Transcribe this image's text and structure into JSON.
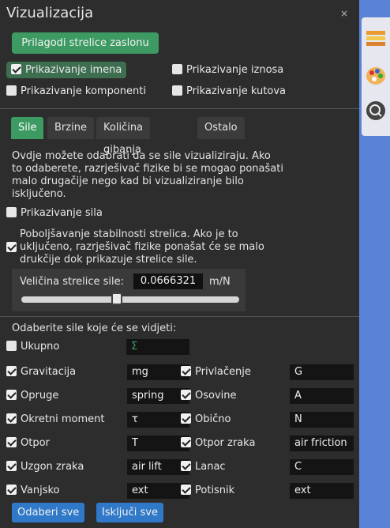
{
  "panel": {
    "title": "Vizualizacija",
    "close_symbol": "×",
    "fit_button": "Prilagodi strelice zaslonu"
  },
  "display_options": [
    {
      "label": "Prikazivanje imena",
      "checked": true,
      "highlight": true
    },
    {
      "label": "Prikazivanje iznosa",
      "checked": false
    },
    {
      "label": "Prikazivanje komponenti",
      "checked": false
    },
    {
      "label": "Prikazivanje kutova",
      "checked": false
    }
  ],
  "tabs": [
    {
      "label": "Sile",
      "active": true
    },
    {
      "label": "Brzine",
      "active": false
    },
    {
      "label": "Količina gibanja",
      "active": false
    },
    {
      "label": "Ostalo",
      "active": false
    }
  ],
  "forces_tab": {
    "description": "Ovdje možete odabrati da se sile vizualiziraju. Ako to odaberete, razrješivač fizike bi se mogao ponašati malo drugačije nego kad bi vizualiziranje bilo isključeno.",
    "show_forces": {
      "label": "Prikazivanje sila",
      "checked": false
    },
    "stabilize": {
      "label": "Poboljšavanje stabilnosti strelica. Ako je to uključeno, razrješivač fizike ponašat će se malo drukčije dok prikazuje strelice sile.",
      "checked": true
    },
    "arrow_size": {
      "label": "Veličina strelice sile:",
      "value": "0.0666321",
      "unit": "m/N",
      "slider_fraction": 0.44
    },
    "select_title": "Odaberite sile koje će se vidjeti:",
    "total": {
      "label": "Ukupno",
      "symbol": "Σ",
      "checked": false
    },
    "forces_left": [
      {
        "label": "Gravitacija",
        "symbol": "mg",
        "checked": true
      },
      {
        "label": "Opruge",
        "symbol": "spring",
        "checked": true
      },
      {
        "label": "Okretni moment",
        "symbol": "τ",
        "checked": true
      },
      {
        "label": "Otpor",
        "symbol": "T",
        "checked": true
      },
      {
        "label": "Uzgon zraka",
        "symbol": "air lift",
        "checked": true
      },
      {
        "label": "Vanjsko",
        "symbol": "ext",
        "checked": true
      }
    ],
    "forces_right": [
      {
        "label": "Privlačenje",
        "symbol": "G",
        "checked": true
      },
      {
        "label": "Osovine",
        "symbol": "A",
        "checked": true
      },
      {
        "label": "Obično",
        "symbol": "N",
        "checked": true
      },
      {
        "label": "Otpor zraka",
        "symbol": "air friction",
        "checked": true
      },
      {
        "label": "Lanac",
        "symbol": "C",
        "checked": true
      },
      {
        "label": "Potisnik",
        "symbol": "ext",
        "checked": true
      }
    ],
    "select_all": "Odaberi sve",
    "deselect_all": "Isključi sve"
  },
  "colors": {
    "accent_green": "#3d9a62",
    "button_blue": "#3079c8",
    "panel_bg": "#2d2d2d",
    "desktop_blue": "#5a83d8"
  },
  "dock_icons": [
    "layers-icon",
    "palette-icon",
    "zoom-icon"
  ]
}
